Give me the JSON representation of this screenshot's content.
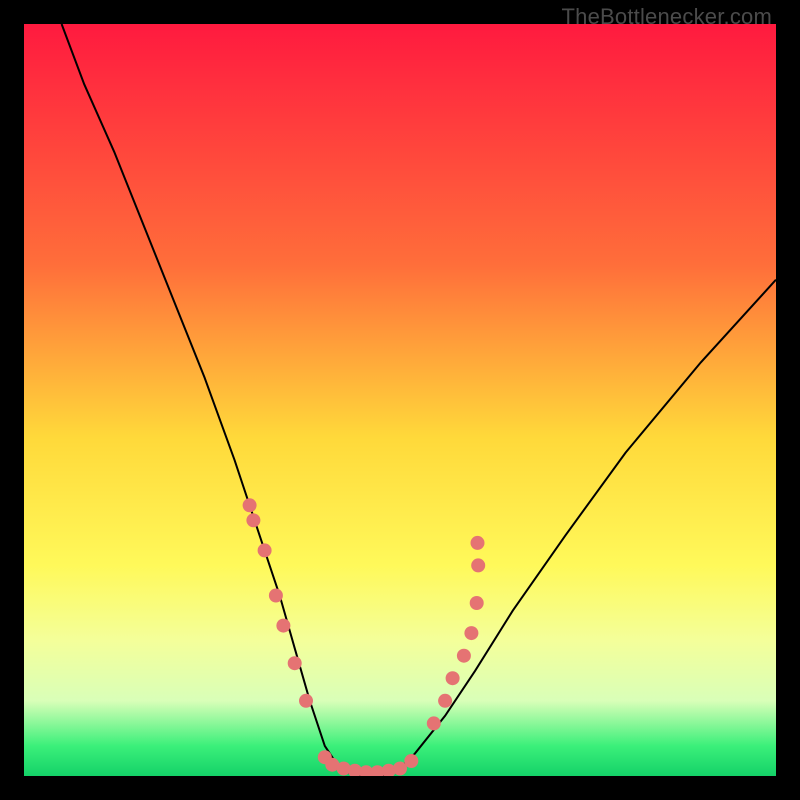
{
  "watermark": "TheBottlenecker.com",
  "chart_data": {
    "type": "line",
    "title": "",
    "xlabel": "",
    "ylabel": "",
    "xlim": [
      0,
      100
    ],
    "ylim": [
      0,
      100
    ],
    "grid": false,
    "background": {
      "gradient_stops": [
        {
          "pos": 0,
          "color": "#ff1a3f"
        },
        {
          "pos": 0.32,
          "color": "#ff6e3a"
        },
        {
          "pos": 0.55,
          "color": "#ffd93a"
        },
        {
          "pos": 0.72,
          "color": "#fff95a"
        },
        {
          "pos": 0.82,
          "color": "#f4ff9a"
        },
        {
          "pos": 0.9,
          "color": "#d9ffb8"
        },
        {
          "pos": 0.96,
          "color": "#3bf07a"
        },
        {
          "pos": 1.0,
          "color": "#14d268"
        }
      ]
    },
    "series": [
      {
        "name": "bottleneck-curve",
        "color": "#000000",
        "width": 2,
        "x": [
          5,
          8,
          12,
          16,
          20,
          24,
          28,
          30,
          32,
          34,
          36,
          38,
          40,
          42,
          44,
          46,
          48,
          50,
          52,
          56,
          60,
          65,
          72,
          80,
          90,
          100
        ],
        "y": [
          100,
          92,
          83,
          73,
          63,
          53,
          42,
          36,
          30,
          24,
          17,
          10,
          4,
          1,
          0,
          0,
          0,
          1,
          3,
          8,
          14,
          22,
          32,
          43,
          55,
          66
        ]
      }
    ],
    "markers": {
      "name": "sample-points",
      "color": "#e57373",
      "radius": 7,
      "points": [
        {
          "x": 30.0,
          "y": 36
        },
        {
          "x": 30.5,
          "y": 34
        },
        {
          "x": 32.0,
          "y": 30
        },
        {
          "x": 33.5,
          "y": 24
        },
        {
          "x": 34.5,
          "y": 20
        },
        {
          "x": 36.0,
          "y": 15
        },
        {
          "x": 37.5,
          "y": 10
        },
        {
          "x": 40.0,
          "y": 2.5
        },
        {
          "x": 41.0,
          "y": 1.5
        },
        {
          "x": 42.5,
          "y": 1.0
        },
        {
          "x": 44.0,
          "y": 0.7
        },
        {
          "x": 45.5,
          "y": 0.5
        },
        {
          "x": 47.0,
          "y": 0.5
        },
        {
          "x": 48.5,
          "y": 0.7
        },
        {
          "x": 50.0,
          "y": 1.0
        },
        {
          "x": 51.5,
          "y": 2.0
        },
        {
          "x": 54.5,
          "y": 7
        },
        {
          "x": 56.0,
          "y": 10
        },
        {
          "x": 57.0,
          "y": 13
        },
        {
          "x": 58.5,
          "y": 16
        },
        {
          "x": 59.5,
          "y": 19
        },
        {
          "x": 60.2,
          "y": 23
        },
        {
          "x": 60.4,
          "y": 28
        },
        {
          "x": 60.3,
          "y": 31
        }
      ]
    }
  }
}
